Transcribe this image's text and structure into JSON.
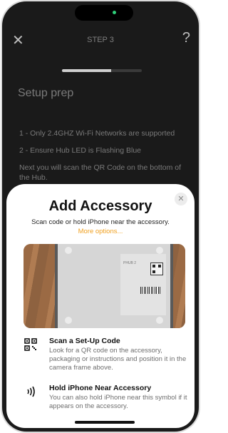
{
  "background": {
    "step_label": "STEP 3",
    "title": "Setup prep",
    "lines": [
      "1 - Only 2.4GHZ Wi-Fi Networks are supported",
      "2 - Ensure Hub LED is Flashing Blue",
      "Next you will scan the QR Code on the bottom of the Hub."
    ],
    "progress_fraction": 0.62
  },
  "sheet": {
    "close_label": "✕",
    "title": "Add Accessory",
    "subtitle": "Scan code or hold iPhone near the accessory.",
    "more_options": "More options...",
    "camera_label": "PHUB 2",
    "options": [
      {
        "icon": "qr-code-icon",
        "title": "Scan a Set-Up Code",
        "description": "Look for a QR code on the accessory, packaging or instructions and position it in the camera frame above."
      },
      {
        "icon": "nfc-icon",
        "title": "Hold iPhone Near Accessory",
        "description": "You can also hold iPhone near this symbol if it appears on the accessory."
      }
    ]
  },
  "colors": {
    "accent": "#f0a020",
    "dim_background": "#1a1a1a",
    "status_dot": "#2fd07a"
  }
}
